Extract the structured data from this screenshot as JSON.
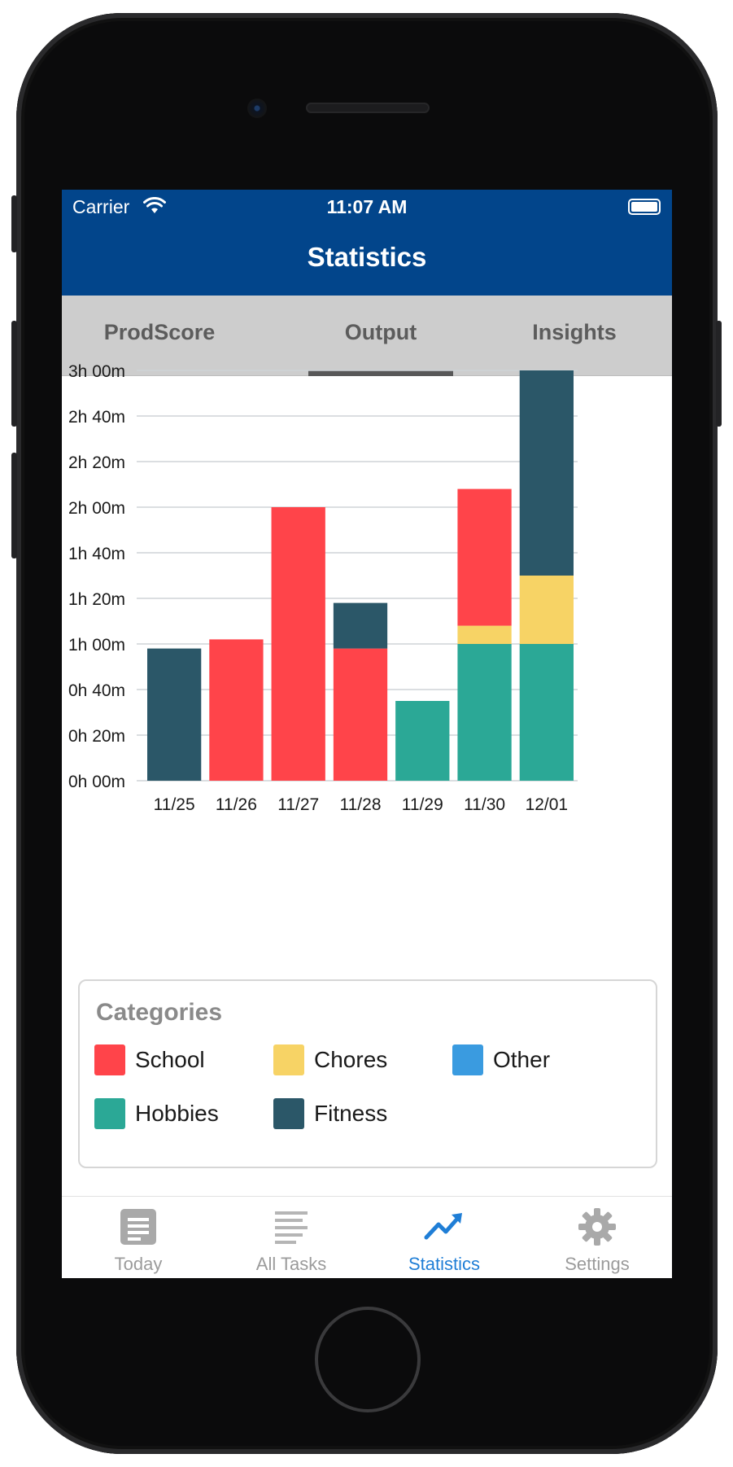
{
  "status_bar": {
    "carrier": "Carrier",
    "time": "11:07 AM"
  },
  "header": {
    "title": "Statistics"
  },
  "tabs": [
    {
      "label": "ProdScore",
      "active": false
    },
    {
      "label": "Output",
      "active": true
    },
    {
      "label": "Insights",
      "active": false
    }
  ],
  "chart_data": {
    "type": "bar",
    "stacked": true,
    "categories": [
      "11/25",
      "11/26",
      "11/27",
      "11/28",
      "11/29",
      "11/30",
      "12/01"
    ],
    "y_unit": "minutes",
    "yticks": [
      "0h 00m",
      "0h 20m",
      "0h 40m",
      "1h 00m",
      "1h 20m",
      "1h 40m",
      "2h 00m",
      "2h 20m",
      "2h 40m",
      "3h 00m"
    ],
    "ylim": [
      0,
      180
    ],
    "series": [
      {
        "name": "Hobbies",
        "color": "#2ba896",
        "values": [
          0,
          0,
          0,
          0,
          35,
          60,
          60
        ]
      },
      {
        "name": "Chores",
        "color": "#f7d365",
        "values": [
          0,
          0,
          0,
          0,
          0,
          8,
          30
        ]
      },
      {
        "name": "School",
        "color": "#ff444a",
        "values": [
          0,
          62,
          120,
          58,
          0,
          60,
          0
        ]
      },
      {
        "name": "Fitness",
        "color": "#2b5768",
        "values": [
          58,
          0,
          0,
          20,
          0,
          0,
          90
        ]
      }
    ],
    "grid": true,
    "legend_position": "below"
  },
  "legend": {
    "title": "Categories",
    "items": [
      {
        "label": "School",
        "color": "#ff444a"
      },
      {
        "label": "Chores",
        "color": "#f7d365"
      },
      {
        "label": "Other",
        "color": "#3a9be0"
      },
      {
        "label": "Hobbies",
        "color": "#2ba896"
      },
      {
        "label": "Fitness",
        "color": "#2b5768"
      }
    ]
  },
  "tab_bar": [
    {
      "label": "Today",
      "icon": "document-icon",
      "active": false
    },
    {
      "label": "All Tasks",
      "icon": "list-icon",
      "active": false
    },
    {
      "label": "Statistics",
      "icon": "trend-up-icon",
      "active": true
    },
    {
      "label": "Settings",
      "icon": "gear-icon",
      "active": false
    }
  ]
}
